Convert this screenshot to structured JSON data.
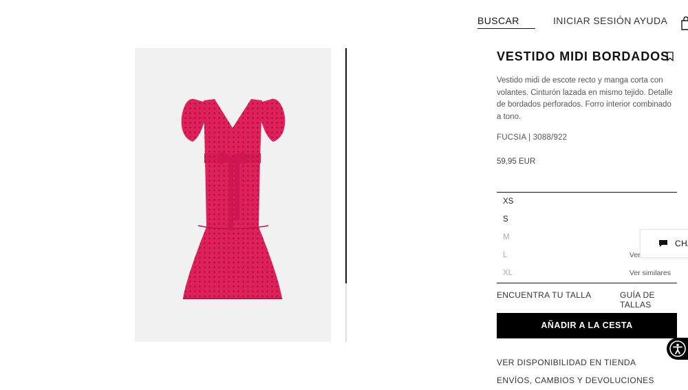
{
  "nav": {
    "search": "BUSCAR",
    "login": "INICIAR SESIÓN",
    "help": "AYUDA",
    "bag_icon": "shopping-bag-icon"
  },
  "product": {
    "title": "VESTIDO MIDI BORDADOS",
    "description": "Vestido midi de escote recto y manga corta con volantes. Cinturón lazada en mismo tejido. Detalle de bordados perforados. Forro interior combinado a tono.",
    "color_ref": "FUCSIA | 3088/922",
    "price": "59,95 EUR",
    "dress_color": "#e0205a",
    "image_background": "#f1f1f1"
  },
  "sizes": [
    {
      "label": "XS",
      "available": true,
      "alt": ""
    },
    {
      "label": "S",
      "available": true,
      "alt": ""
    },
    {
      "label": "M",
      "available": false,
      "alt": ""
    },
    {
      "label": "L",
      "available": false,
      "alt": "Ver similares"
    },
    {
      "label": "XL",
      "available": false,
      "alt": "Ver similares"
    }
  ],
  "size_tools": {
    "find": "ENCUENTRA TU TALLA",
    "guide": "GUÍA DE TALLAS"
  },
  "cta": {
    "add_to_cart": "AÑADIR A LA CESTA"
  },
  "links": {
    "store_availability": "VER DISPONIBILIDAD EN TIENDA",
    "shipping": "ENVÍOS, CAMBIOS Y DEVOLUCIONES"
  },
  "chat": {
    "label": "CHA"
  }
}
